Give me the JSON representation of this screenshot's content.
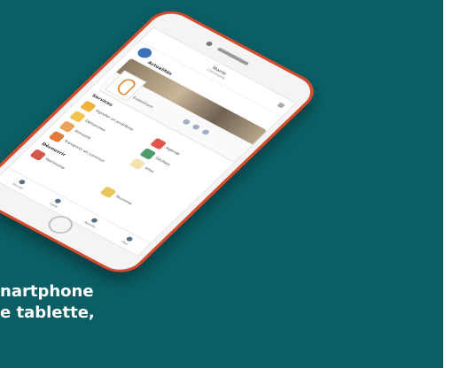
{
  "caption": {
    "line1": "nartphone",
    "line2": "e tablette,"
  },
  "app": {
    "title": "Mairie",
    "subtitle": "Commune",
    "sections": {
      "news": "Actualités",
      "services": "Services",
      "discover": "Découvrir"
    },
    "card": {
      "label": "Événement"
    },
    "services": [
      {
        "label": "Signaler un problème",
        "color": "#f0b23a"
      },
      {
        "label": "Agenda",
        "color": "#e0564a"
      },
      {
        "label": "Démarches",
        "color": "#f3c24e"
      },
      {
        "label": "Déchets",
        "color": "#4f9a6a"
      },
      {
        "label": "Annuaire",
        "color": "#e9a55b"
      },
      {
        "label": "Infos",
        "color": "#f4e2b0"
      },
      {
        "label": "Transports en commun",
        "color": "#e47a3a"
      }
    ],
    "discover": [
      {
        "label": "Patrimoine",
        "color": "#d4574a"
      },
      {
        "label": "Tourisme",
        "color": "#e9c65a"
      }
    ],
    "tabs": [
      {
        "label": "Accueil"
      },
      {
        "label": "Carte"
      },
      {
        "label": "Agenda"
      },
      {
        "label": "Plus"
      }
    ]
  },
  "colors": {
    "background": "#0a5e64",
    "phone_frame": "#d24b2c",
    "caption_text": "#ffffff"
  }
}
